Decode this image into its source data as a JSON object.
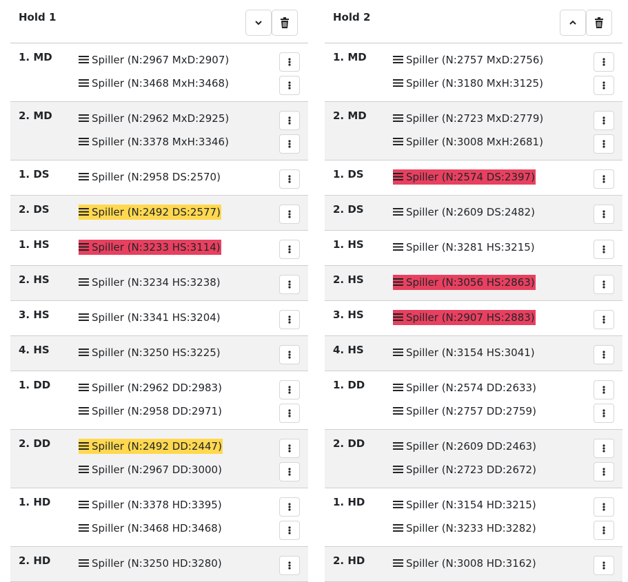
{
  "teams": [
    {
      "title": "Hold 1",
      "toggle_icon": "chevron-down-icon",
      "delete_icon": "trash-icon",
      "rows": [
        {
          "pos": "1. MD",
          "players": [
            {
              "text": "Spiller (N:2967 MxD:2907)",
              "hl": ""
            },
            {
              "text": "Spiller (N:3468 MxH:3468)",
              "hl": ""
            }
          ]
        },
        {
          "pos": "2. MD",
          "players": [
            {
              "text": "Spiller (N:2962 MxD:2925)",
              "hl": ""
            },
            {
              "text": "Spiller (N:3378 MxH:3346)",
              "hl": ""
            }
          ]
        },
        {
          "pos": "1. DS",
          "players": [
            {
              "text": "Spiller (N:2958 DS:2570)",
              "hl": ""
            }
          ]
        },
        {
          "pos": "2. DS",
          "players": [
            {
              "text": "Spiller (N:2492 DS:2577)",
              "hl": "yellow"
            }
          ]
        },
        {
          "pos": "1. HS",
          "players": [
            {
              "text": "Spiller (N:3233 HS:3114)",
              "hl": "red"
            }
          ]
        },
        {
          "pos": "2. HS",
          "players": [
            {
              "text": "Spiller (N:3234 HS:3238)",
              "hl": ""
            }
          ]
        },
        {
          "pos": "3. HS",
          "players": [
            {
              "text": "Spiller (N:3341 HS:3204)",
              "hl": ""
            }
          ]
        },
        {
          "pos": "4. HS",
          "players": [
            {
              "text": "Spiller (N:3250 HS:3225)",
              "hl": ""
            }
          ]
        },
        {
          "pos": "1. DD",
          "players": [
            {
              "text": "Spiller (N:2962 DD:2983)",
              "hl": ""
            },
            {
              "text": "Spiller (N:2958 DD:2971)",
              "hl": ""
            }
          ]
        },
        {
          "pos": "2. DD",
          "players": [
            {
              "text": "Spiller (N:2492 DD:2447)",
              "hl": "yellow"
            },
            {
              "text": "Spiller (N:2967 DD:3000)",
              "hl": ""
            }
          ]
        },
        {
          "pos": "1. HD",
          "players": [
            {
              "text": "Spiller (N:3378 HD:3395)",
              "hl": ""
            },
            {
              "text": "Spiller (N:3468 HD:3468)",
              "hl": ""
            }
          ]
        },
        {
          "pos": "2. HD",
          "players": [
            {
              "text": "Spiller (N:3250 HD:3280)",
              "hl": ""
            }
          ]
        }
      ]
    },
    {
      "title": "Hold 2",
      "toggle_icon": "chevron-up-icon",
      "delete_icon": "trash-icon",
      "rows": [
        {
          "pos": "1. MD",
          "players": [
            {
              "text": "Spiller (N:2757 MxD:2756)",
              "hl": ""
            },
            {
              "text": "Spiller (N:3180 MxH:3125)",
              "hl": ""
            }
          ]
        },
        {
          "pos": "2. MD",
          "players": [
            {
              "text": "Spiller (N:2723 MxD:2779)",
              "hl": ""
            },
            {
              "text": "Spiller (N:3008 MxH:2681)",
              "hl": ""
            }
          ]
        },
        {
          "pos": "1. DS",
          "players": [
            {
              "text": "Spiller (N:2574 DS:2397)",
              "hl": "red"
            }
          ]
        },
        {
          "pos": "2. DS",
          "players": [
            {
              "text": "Spiller (N:2609 DS:2482)",
              "hl": ""
            }
          ]
        },
        {
          "pos": "1. HS",
          "players": [
            {
              "text": "Spiller (N:3281 HS:3215)",
              "hl": ""
            }
          ]
        },
        {
          "pos": "2. HS",
          "players": [
            {
              "text": "Spiller (N:3056 HS:2863)",
              "hl": "red"
            }
          ]
        },
        {
          "pos": "3. HS",
          "players": [
            {
              "text": "Spiller (N:2907 HS:2883)",
              "hl": "red"
            }
          ]
        },
        {
          "pos": "4. HS",
          "players": [
            {
              "text": "Spiller (N:3154 HS:3041)",
              "hl": ""
            }
          ]
        },
        {
          "pos": "1. DD",
          "players": [
            {
              "text": "Spiller (N:2574 DD:2633)",
              "hl": ""
            },
            {
              "text": "Spiller (N:2757 DD:2759)",
              "hl": ""
            }
          ]
        },
        {
          "pos": "2. DD",
          "players": [
            {
              "text": "Spiller (N:2609 DD:2463)",
              "hl": ""
            },
            {
              "text": "Spiller (N:2723 DD:2672)",
              "hl": ""
            }
          ]
        },
        {
          "pos": "1. HD",
          "players": [
            {
              "text": "Spiller (N:3154 HD:3215)",
              "hl": ""
            },
            {
              "text": "Spiller (N:3233 HD:3282)",
              "hl": ""
            }
          ]
        },
        {
          "pos": "2. HD",
          "players": [
            {
              "text": "Spiller (N:3008 HD:3162)",
              "hl": ""
            }
          ]
        }
      ]
    }
  ],
  "icons": {
    "player_handle": "drag-handle-icon",
    "player_menu": "more-vertical-icon"
  },
  "colors": {
    "highlight_yellow": "#ffd84f",
    "highlight_red": "#e8405f",
    "alt_row": "#f2f2f2"
  }
}
